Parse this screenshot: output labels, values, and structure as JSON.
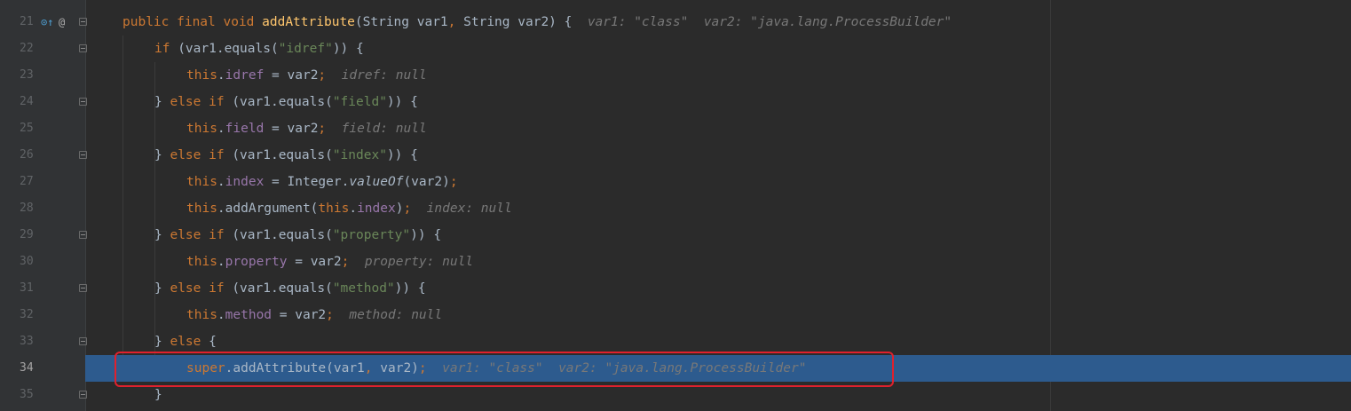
{
  "lines": [
    {
      "num": "21",
      "tokens": [
        [
          "kw",
          "public final void "
        ],
        [
          "fn",
          "addAttribute"
        ],
        [
          "plain",
          "(String var1"
        ],
        [
          "kw",
          ", "
        ],
        [
          "plain",
          "String var2) {  "
        ],
        [
          "hint",
          "var1: \"class\"  var2: \"java.lang.ProcessBuilder\""
        ]
      ]
    },
    {
      "num": "22",
      "tokens": [
        [
          "kw",
          "if "
        ],
        [
          "plain",
          "(var1.equals("
        ],
        [
          "str",
          "\"idref\""
        ],
        [
          "plain",
          ")) {"
        ]
      ]
    },
    {
      "num": "23",
      "tokens": [
        [
          "kw",
          "this"
        ],
        [
          "plain",
          "."
        ],
        [
          "fld",
          "idref"
        ],
        [
          "plain",
          " = var2"
        ],
        [
          "kw",
          ";"
        ],
        [
          "plain",
          "  "
        ],
        [
          "hint",
          "idref: null"
        ]
      ]
    },
    {
      "num": "24",
      "tokens": [
        [
          "plain",
          "} "
        ],
        [
          "kw",
          "else if "
        ],
        [
          "plain",
          "(var1.equals("
        ],
        [
          "str",
          "\"field\""
        ],
        [
          "plain",
          ")) {"
        ]
      ]
    },
    {
      "num": "25",
      "tokens": [
        [
          "kw",
          "this"
        ],
        [
          "plain",
          "."
        ],
        [
          "fld",
          "field"
        ],
        [
          "plain",
          " = var2"
        ],
        [
          "kw",
          ";"
        ],
        [
          "plain",
          "  "
        ],
        [
          "hint",
          "field: null"
        ]
      ]
    },
    {
      "num": "26",
      "tokens": [
        [
          "plain",
          "} "
        ],
        [
          "kw",
          "else if "
        ],
        [
          "plain",
          "(var1.equals("
        ],
        [
          "str",
          "\"index\""
        ],
        [
          "plain",
          ")) {"
        ]
      ]
    },
    {
      "num": "27",
      "tokens": [
        [
          "kw",
          "this"
        ],
        [
          "plain",
          "."
        ],
        [
          "fld",
          "index"
        ],
        [
          "plain",
          " = Integer."
        ],
        [
          "it",
          "valueOf"
        ],
        [
          "plain",
          "(var2)"
        ],
        [
          "kw",
          ";"
        ]
      ]
    },
    {
      "num": "28",
      "tokens": [
        [
          "kw",
          "this"
        ],
        [
          "plain",
          ".addArgument("
        ],
        [
          "kw",
          "this"
        ],
        [
          "plain",
          "."
        ],
        [
          "fld",
          "index"
        ],
        [
          "plain",
          ")"
        ],
        [
          "kw",
          ";"
        ],
        [
          "plain",
          "  "
        ],
        [
          "hint",
          "index: null"
        ]
      ]
    },
    {
      "num": "29",
      "tokens": [
        [
          "plain",
          "} "
        ],
        [
          "kw",
          "else if "
        ],
        [
          "plain",
          "(var1.equals("
        ],
        [
          "str",
          "\"property\""
        ],
        [
          "plain",
          ")) {"
        ]
      ]
    },
    {
      "num": "30",
      "tokens": [
        [
          "kw",
          "this"
        ],
        [
          "plain",
          "."
        ],
        [
          "fld",
          "property"
        ],
        [
          "plain",
          " = var2"
        ],
        [
          "kw",
          ";"
        ],
        [
          "plain",
          "  "
        ],
        [
          "hint",
          "property: null"
        ]
      ]
    },
    {
      "num": "31",
      "tokens": [
        [
          "plain",
          "} "
        ],
        [
          "kw",
          "else if "
        ],
        [
          "plain",
          "(var1.equals("
        ],
        [
          "str",
          "\"method\""
        ],
        [
          "plain",
          ")) {"
        ]
      ]
    },
    {
      "num": "32",
      "tokens": [
        [
          "kw",
          "this"
        ],
        [
          "plain",
          "."
        ],
        [
          "fld",
          "method"
        ],
        [
          "plain",
          " = var2"
        ],
        [
          "kw",
          ";"
        ],
        [
          "plain",
          "  "
        ],
        [
          "hint",
          "method: null"
        ]
      ]
    },
    {
      "num": "33",
      "tokens": [
        [
          "plain",
          "} "
        ],
        [
          "kw",
          "else "
        ],
        [
          "plain",
          "{"
        ]
      ]
    },
    {
      "num": "34",
      "tokens": [
        [
          "kw",
          "super"
        ],
        [
          "plain",
          ".addAttribute(var1"
        ],
        [
          "kw",
          ", "
        ],
        [
          "plain",
          "var2)"
        ],
        [
          "kw",
          ";"
        ],
        [
          "plain",
          "  "
        ],
        [
          "hint",
          "var1: \"class\"  var2: \"java.lang.ProcessBuilder\""
        ]
      ]
    },
    {
      "num": "35",
      "tokens": [
        [
          "plain",
          "}"
        ]
      ]
    }
  ],
  "current_line": "34",
  "gutter_icons": {
    "override": "⊙↑",
    "annotation": "@"
  },
  "colors": {
    "background": "#2b2b2b",
    "gutter": "#313335",
    "current_line": "#2d5b8e",
    "keyword": "#cc7832",
    "method": "#ffc66d",
    "string": "#6a8759",
    "field": "#9876aa",
    "hint": "#787878",
    "highlight_box": "#e0212d"
  }
}
